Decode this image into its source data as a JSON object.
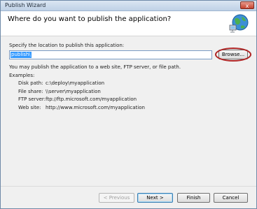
{
  "window": {
    "title": "Publish Wizard",
    "close_label": "x"
  },
  "header": {
    "title": "Where do you want to publish the application?",
    "icon": "globe-network-icon"
  },
  "location": {
    "label": "Specify the location to publish this application:",
    "value": "publish\\",
    "browse_label": "Browse..."
  },
  "info_text": "You may publish the application to a web site, FTP server, or file path.",
  "examples": {
    "heading": "Examples:",
    "rows": [
      {
        "label": "Disk path:",
        "value": "c:\\deploy\\myapplication"
      },
      {
        "label": "File share:",
        "value": "\\\\server\\myapplication"
      },
      {
        "label": "FTP server:",
        "value": "ftp://ftp.microsoft.com/myapplication"
      },
      {
        "label": "Web site:",
        "value": "http://www.microsoft.com/myapplication"
      }
    ]
  },
  "buttons": {
    "previous": "< Previous",
    "next": "Next >",
    "finish": "Finish",
    "cancel": "Cancel"
  },
  "colors": {
    "highlight_ring": "#b02525",
    "selection": "#3399ff"
  }
}
